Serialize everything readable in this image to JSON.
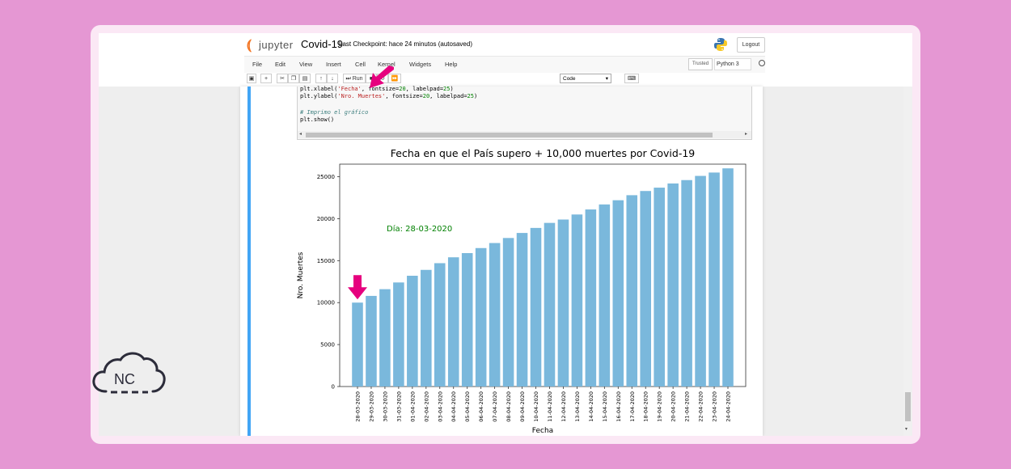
{
  "app": {
    "logo_text": "jupyter",
    "notebook_name": "Covid-19",
    "checkpoint": "Last Checkpoint: hace 24 minutos  (autosaved)",
    "logout_label": "Logout",
    "trusted_label": "Trusted",
    "kernel_label": "Python 3"
  },
  "menu": [
    "File",
    "Edit",
    "View",
    "Insert",
    "Cell",
    "Kernel",
    "Widgets",
    "Help"
  ],
  "toolbar": {
    "run_label": "Run",
    "celltype_value": "Code"
  },
  "code": {
    "line1_a": "plt.xlabel(",
    "line1_str": "'Fecha'",
    "line1_b": ", fontsize=",
    "line1_n1": "20",
    "line1_c": ", labelpad=",
    "line1_n2": "25",
    "line1_d": ")",
    "line2_a": "plt.ylabel(",
    "line2_str": "'Nro. Muertes'",
    "line2_b": ", fontsize=",
    "line2_n1": "20",
    "line2_c": ", labelpad=",
    "line2_n2": "25",
    "line2_d": ")",
    "comment": "# Imprimo el gráfico",
    "line4": "plt.show()"
  },
  "chart_data": {
    "type": "bar",
    "title": "Fecha en que el País supero + 10,000 muertes por Covid-19",
    "xlabel": "Fecha",
    "ylabel": "Nro. Muertes",
    "annotation": "Día: 28-03-2020",
    "ylim": [
      0,
      26500
    ],
    "yticks": [
      0,
      5000,
      10000,
      15000,
      20000,
      25000
    ],
    "bar_color": "#7ab8dc",
    "categories": [
      "28-03-2020",
      "29-03-2020",
      "30-03-2020",
      "31-03-2020",
      "01-04-2020",
      "02-04-2020",
      "03-04-2020",
      "04-04-2020",
      "05-04-2020",
      "06-04-2020",
      "07-04-2020",
      "08-04-2020",
      "09-04-2020",
      "10-04-2020",
      "11-04-2020",
      "12-04-2020",
      "13-04-2020",
      "14-04-2020",
      "15-04-2020",
      "16-04-2020",
      "17-04-2020",
      "18-04-2020",
      "19-04-2020",
      "20-04-2020",
      "21-04-2020",
      "22-04-2020",
      "23-04-2020",
      "24-04-2020"
    ],
    "values": [
      10000,
      10800,
      11600,
      12400,
      13200,
      13900,
      14700,
      15400,
      15900,
      16500,
      17100,
      17700,
      18300,
      18900,
      19500,
      19900,
      20500,
      21100,
      21700,
      22200,
      22800,
      23300,
      23700,
      24200,
      24600,
      25100,
      25500,
      26000
    ]
  },
  "colors": {
    "highlight_arrow": "#e6007e",
    "annotation": "#008000",
    "cell_selected": "#42a5f5"
  }
}
